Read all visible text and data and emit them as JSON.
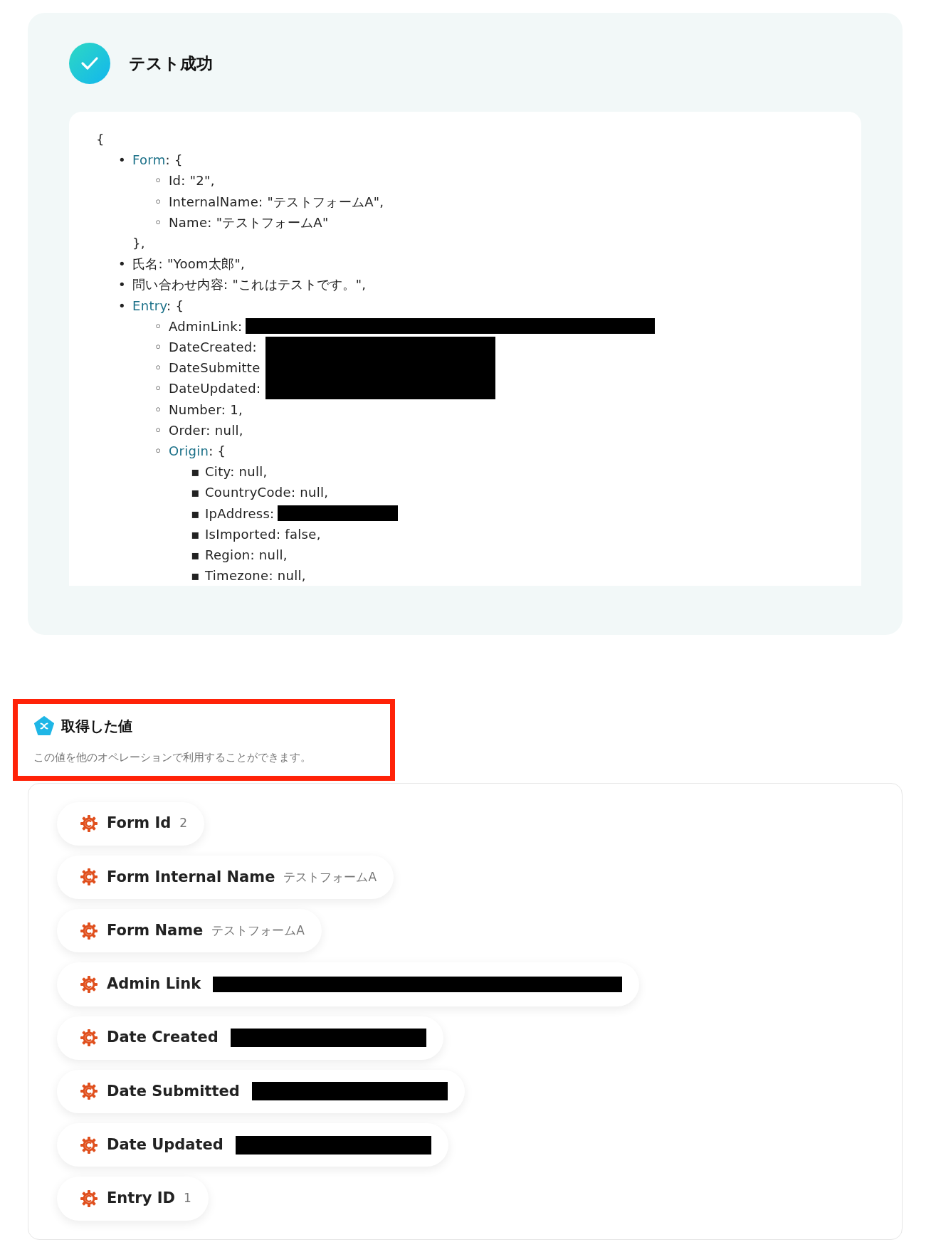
{
  "test_result": {
    "title": "テスト成功",
    "open_brace": "{",
    "tree": [
      {
        "marker": "•",
        "key": "Form",
        "link": true,
        "text": ": {",
        "close": "},",
        "children": [
          {
            "marker": "◦",
            "key": "Id",
            "text": ": \"2\","
          },
          {
            "marker": "◦",
            "key": "InternalName",
            "text": ": \"テストフォームA\","
          },
          {
            "marker": "◦",
            "key": "Name",
            "text": ": \"テストフォームA\""
          }
        ]
      },
      {
        "marker": "•",
        "key": "氏名",
        "text": ": \"Yoom太郎\","
      },
      {
        "marker": "•",
        "key": "問い合わせ内容",
        "text": ": \"これはテストです。\","
      },
      {
        "marker": "•",
        "key": "Entry",
        "link": true,
        "text": ": {",
        "children": [
          {
            "marker": "◦",
            "key": "AdminLink",
            "text": ":",
            "kind": "redacted_long"
          },
          {
            "marker": "◦",
            "key": "DateCreated",
            "text": ":",
            "kind": "redacted_block"
          },
          {
            "marker": "◦",
            "key": "DateSubmitte",
            "kind": "redacted_block"
          },
          {
            "marker": "◦",
            "key": "DateUpdated",
            "text": ":",
            "kind": "redacted_block"
          },
          {
            "marker": "◦",
            "key": "Number",
            "text": ": 1,"
          },
          {
            "marker": "◦",
            "key": "Order",
            "text": ": null,"
          },
          {
            "marker": "◦",
            "key": "Origin",
            "link": true,
            "text": ": {",
            "children": [
              {
                "marker": "▪",
                "key": "City",
                "text": ": null,"
              },
              {
                "marker": "▪",
                "key": "CountryCode",
                "text": ": null,"
              },
              {
                "marker": "▪",
                "key": "IpAddress",
                "text": ":",
                "kind": "redacted_short"
              },
              {
                "marker": "▪",
                "key": "IsImported",
                "text": ": false,"
              },
              {
                "marker": "▪",
                "key": "Region",
                "text": ": null,"
              },
              {
                "marker": "▪",
                "key": "Timezone",
                "text": ": null,"
              }
            ]
          }
        ]
      }
    ]
  },
  "obtained_values": {
    "title": "取得した値",
    "description": "この値を他のオペレーションで利用することができます。",
    "highlighted": true,
    "items": [
      {
        "label": "Form Id",
        "value": "2"
      },
      {
        "label": "Form Internal Name",
        "value": "テストフォームA"
      },
      {
        "label": "Form Name",
        "value": "テストフォームA"
      },
      {
        "label": "Admin Link",
        "kind": "redacted_long"
      },
      {
        "label": "Date Created",
        "kind": "redacted_medium"
      },
      {
        "label": "Date Submitted",
        "kind": "redacted_medium"
      },
      {
        "label": "Date Updated",
        "kind": "redacted_medium"
      },
      {
        "label": "Entry ID",
        "value": "1"
      }
    ]
  }
}
